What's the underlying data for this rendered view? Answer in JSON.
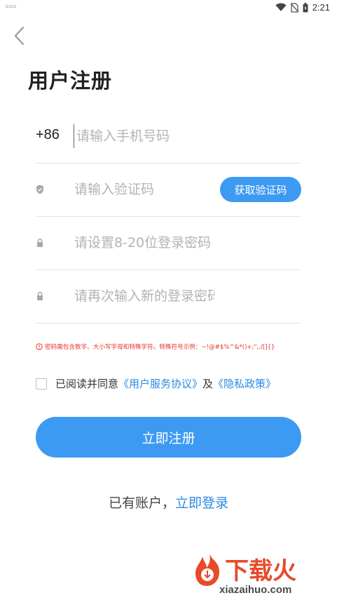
{
  "status_bar": {
    "left_text": "▫▫▫",
    "time": "2:21",
    "icons": [
      "wifi-icon",
      "no-sim-icon",
      "battery-icon"
    ]
  },
  "header": {
    "back_icon": "chevron-left-icon",
    "title": "用户注册"
  },
  "form": {
    "country_code": "+86",
    "phone_placeholder": "请输入手机号码",
    "code_placeholder": "请输入验证码",
    "get_code_label": "获取验证码",
    "password_placeholder": "请设置8-20位登录密码",
    "confirm_placeholder": "请再次输入新的登录密码",
    "icons": {
      "code": "shield-icon",
      "password": "lock-icon",
      "confirm": "lock-icon"
    }
  },
  "hint": {
    "icon": "alert-circle-icon",
    "text": "密码需包含数字、大小写字母和特殊字符。特殊符号示例：~!@#$%^&*()+;\",./[]{}"
  },
  "agreement": {
    "prefix": "已阅读并同意",
    "terms": "《用户服务协议》",
    "and": "及",
    "privacy": "《隐私政策》"
  },
  "register_label": "立即注册",
  "login": {
    "prefix": "已有账户，",
    "link": "立即登录"
  },
  "watermark": {
    "brand": "下载火",
    "url": "xiazaihuo.com"
  },
  "colors": {
    "accent": "#3d9af2",
    "link": "#2a8be0",
    "error": "#e8332a",
    "watermark": "#e84a2a"
  }
}
